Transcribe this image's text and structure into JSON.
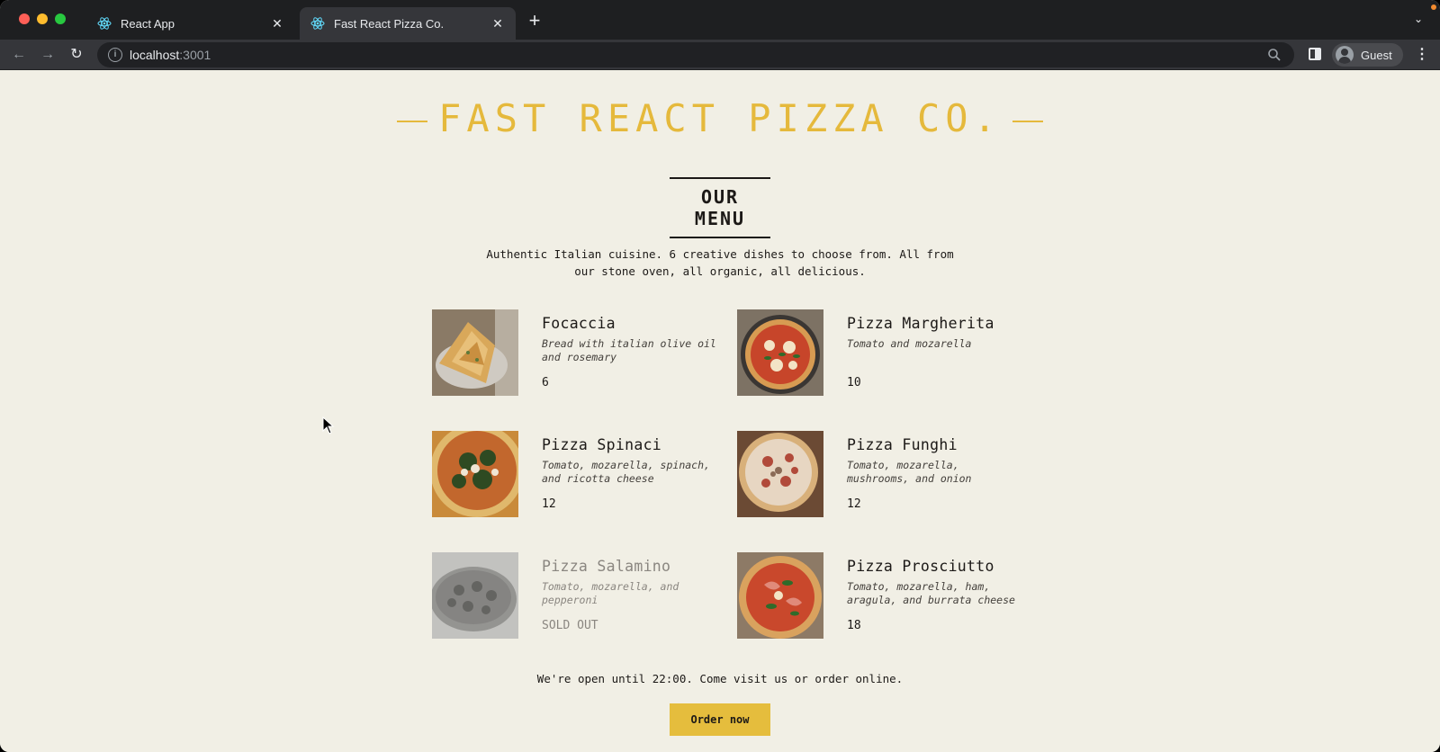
{
  "browser": {
    "tabs": [
      {
        "title": "React App",
        "active": false
      },
      {
        "title": "Fast React Pizza Co.",
        "active": true
      }
    ],
    "new_tab_symbol": "+",
    "url_host": "localhost",
    "url_port": ":3001",
    "profile_name": "Guest",
    "colors": {
      "chrome_dark": "#1e1f21",
      "tab_active": "#35363a",
      "omnibox": "#202124"
    }
  },
  "page": {
    "logo": "FAST REACT PIZZA CO.",
    "menu_heading": "OUR MENU",
    "intro": "Authentic Italian cuisine. 6 creative dishes to choose from. All from our stone oven, all organic, all delicious.",
    "pizzas": [
      {
        "name": "Focaccia",
        "ingredients": "Bread with italian olive oil and rosemary",
        "price": "6",
        "sold_out": false,
        "image_icon": "focaccia-photo"
      },
      {
        "name": "Pizza Margherita",
        "ingredients": "Tomato and mozarella",
        "price": "10",
        "sold_out": false,
        "image_icon": "margherita-photo"
      },
      {
        "name": "Pizza Spinaci",
        "ingredients": "Tomato, mozarella, spinach, and ricotta cheese",
        "price": "12",
        "sold_out": false,
        "image_icon": "spinaci-photo"
      },
      {
        "name": "Pizza Funghi",
        "ingredients": "Tomato, mozarella, mushrooms, and onion",
        "price": "12",
        "sold_out": false,
        "image_icon": "funghi-photo"
      },
      {
        "name": "Pizza Salamino",
        "ingredients": "Tomato, mozarella, and pepperoni",
        "price": "SOLD OUT",
        "sold_out": true,
        "image_icon": "salamino-photo"
      },
      {
        "name": "Pizza Prosciutto",
        "ingredients": "Tomato, mozarella, ham, aragula, and burrata cheese",
        "price": "18",
        "sold_out": false,
        "image_icon": "prosciutto-photo"
      }
    ],
    "footer_text": "We're open until 22:00. Come visit us or order online.",
    "order_button": "Order now",
    "colors": {
      "background": "#f1efe5",
      "accent": "#e5b93c",
      "text": "#1c1917"
    }
  }
}
